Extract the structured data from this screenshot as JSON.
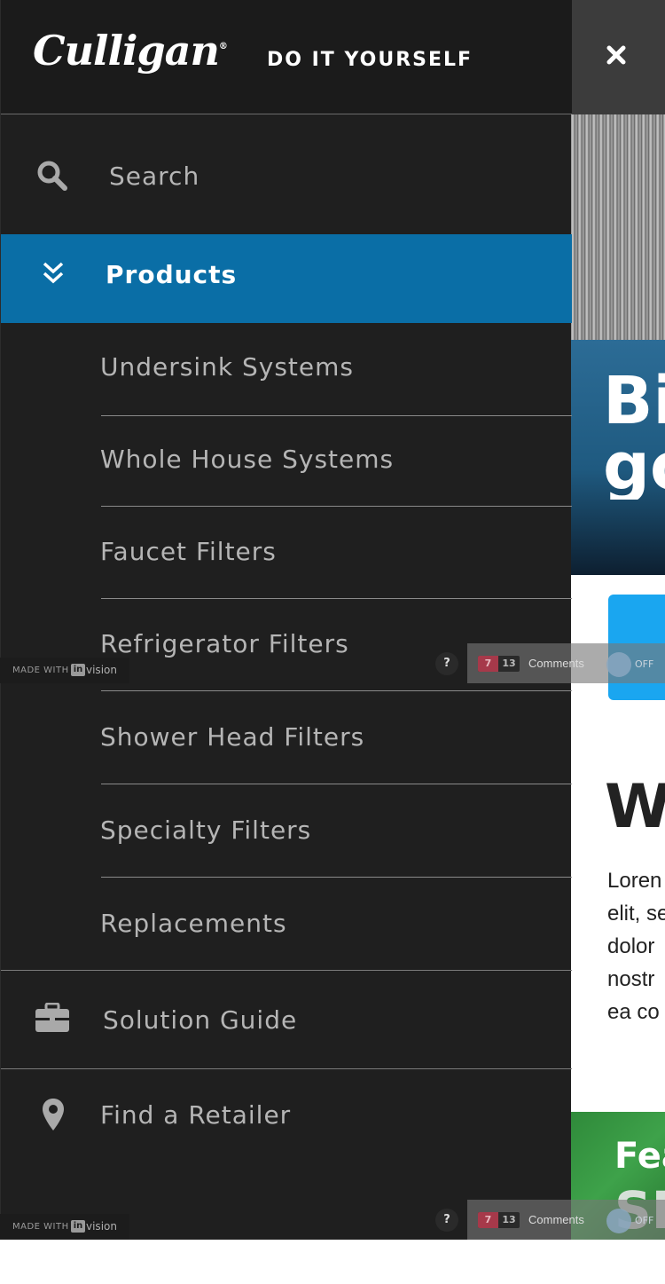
{
  "brand": {
    "logo_text": "Culligan",
    "registered": "®",
    "tagline": "DO IT YOURSELF"
  },
  "nav": {
    "search_label": "Search",
    "products_label": "Products",
    "product_items": [
      "Undersink Systems",
      "Whole House Systems",
      "Faucet Filters",
      "Refrigerator Filters",
      "Shower Head Filters",
      "Specialty Filters",
      "Replacements"
    ],
    "solution_guide_label": "Solution Guide",
    "find_retailer_label": "Find a Retailer"
  },
  "page_peek": {
    "hero_text_line1": "Bi",
    "hero_text_line2": "go",
    "section_heading": "Wl",
    "body_lines": [
      "Loren",
      "elit, se",
      "dolor",
      "nostr",
      "ea co"
    ],
    "feature_title": "Fea",
    "feature_subtitle": "SH"
  },
  "invision": {
    "made_with": "MADE WITH",
    "in_mark": "in",
    "vision": "vision",
    "help": "?",
    "count_unread": "7",
    "count_total": "13",
    "comments_label": "Comments",
    "toggle_label": "OFF"
  },
  "colors": {
    "drawer_bg": "#1f1f1f",
    "active_item_bg": "#0a6ea6",
    "cta_blue": "#1aa6f0",
    "feature_green": "#3ea24a"
  },
  "icons": {
    "close": "close-icon",
    "search": "search-icon",
    "products": "chevron-double-down-icon",
    "solution_guide": "briefcase-icon",
    "find_retailer": "map-pin-icon"
  }
}
